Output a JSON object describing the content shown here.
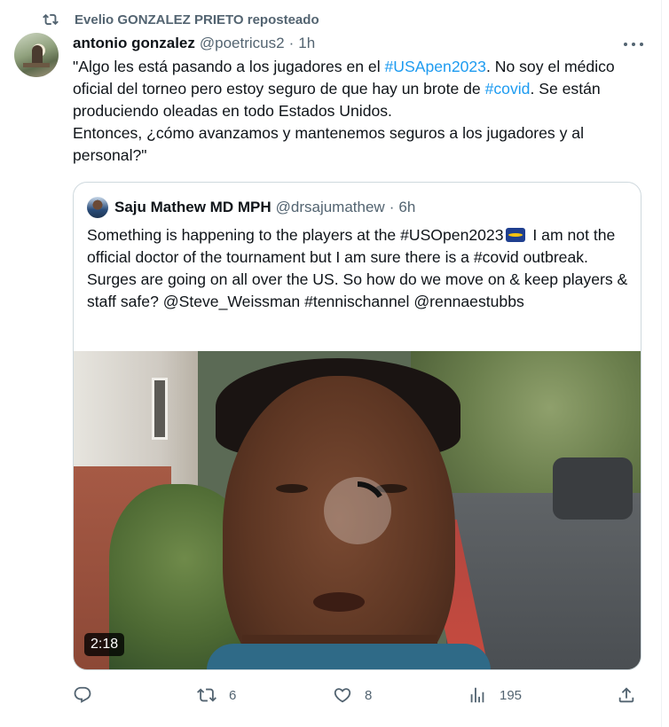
{
  "repost": {
    "text": "Evelio GONZALEZ PRIETO reposteado",
    "icon": "repost-icon"
  },
  "tweet": {
    "author_name": "antonio gonzalez",
    "author_handle": "@poetricus2",
    "separator": "·",
    "time": "1h",
    "text_parts": {
      "p1": "\"Algo les está pasando a los jugadores en el ",
      "tag1": "#USApen2023",
      "p2": ". No soy el médico oficial del torneo pero estoy seguro de que hay un brote de ",
      "tag2": "#covid",
      "p3": ". Se están produciendo oleadas en todo Estados Unidos.",
      "p4": "Entonces, ¿cómo avanzamos y mantenemos seguros a los jugadores y al personal?\""
    }
  },
  "quote": {
    "author_name": "Saju Mathew MD MPH",
    "author_handle": "@drsajumathew",
    "separator": "·",
    "time": "6h",
    "text_a": "Something is happening to the players at the #USOpen2023",
    "text_b": " I am not the official doctor of the tournament but I am sure there is a #covid outbreak. Surges are going on all over the US. So how do we move on & keep players & staff safe? @Steve_Weissman #tennischannel @rennaestubbs",
    "video_duration": "2:18",
    "video_progress_fraction": 0.16
  },
  "actions": {
    "reply_count": "",
    "repost_count": "6",
    "like_count": "8",
    "views_count": "195"
  },
  "colors": {
    "link": "#1d9bf0",
    "secondary_text": "#536471",
    "border": "#cfd9de"
  }
}
